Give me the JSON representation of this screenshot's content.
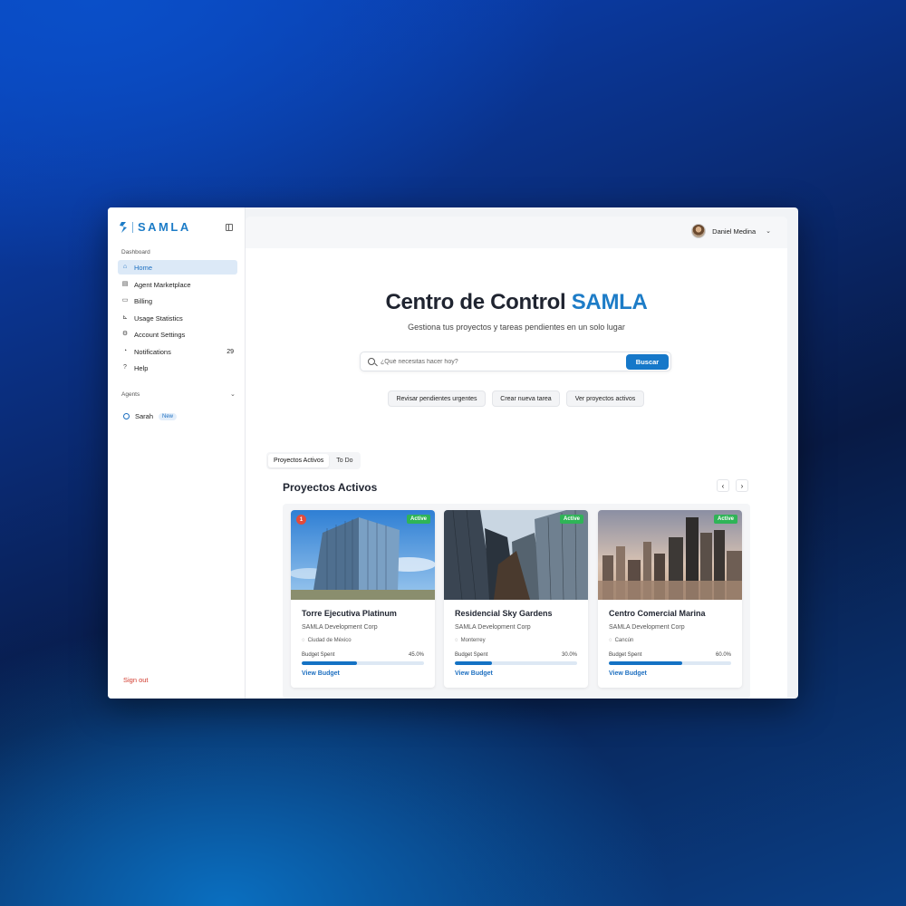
{
  "sidebar": {
    "brand": "SAMLA",
    "dashboard_label": "Dashboard",
    "items": [
      {
        "label": "Home",
        "icon": "home-icon",
        "active": true
      },
      {
        "label": "Agent Marketplace",
        "icon": "store-icon"
      },
      {
        "label": "Billing",
        "icon": "card-icon"
      },
      {
        "label": "Usage Statistics",
        "icon": "chart-icon"
      },
      {
        "label": "Account Settings",
        "icon": "gear-icon"
      },
      {
        "label": "Notifications",
        "icon": "bell-icon",
        "count": "29"
      },
      {
        "label": "Help",
        "icon": "help-icon"
      }
    ],
    "agents_label": "Agents",
    "agents": [
      {
        "name": "Sarah",
        "badge": "New"
      }
    ],
    "signout": "Sign out"
  },
  "header": {
    "user_name": "Daniel Medina"
  },
  "hero": {
    "title_main": "Centro de Control ",
    "title_accent": "SAMLA",
    "subtitle": "Gestiona tus proyectos y tareas pendientes en un solo lugar",
    "search_placeholder": "¿Qué necesitas hacer hoy?",
    "search_button": "Buscar",
    "quick_actions": [
      "Revisar pendientes urgentes",
      "Crear nueva tarea",
      "Ver proyectos activos"
    ]
  },
  "tabs": [
    "Proyectos Activos",
    "To Do"
  ],
  "projects_title": "Proyectos Activos",
  "projects": [
    {
      "title": "Torre Ejecutiva Platinum",
      "company": "SAMLA Development Corp",
      "location": "Ciudad de México",
      "status": "Active",
      "alert": "1",
      "budget_label": "Budget Spent",
      "budget_pct": "45.0%",
      "budget_value": 45,
      "link": "View Budget"
    },
    {
      "title": "Residencial Sky Gardens",
      "company": "SAMLA Development Corp",
      "location": "Monterrey",
      "status": "Active",
      "budget_label": "Budget Spent",
      "budget_pct": "30.0%",
      "budget_value": 30,
      "link": "View Budget"
    },
    {
      "title": "Centro Comercial Marina",
      "company": "SAMLA Development Corp",
      "location": "Cancún",
      "status": "Active",
      "budget_label": "Budget Spent",
      "budget_pct": "60.0%",
      "budget_value": 60,
      "link": "View Budget"
    }
  ],
  "colors": {
    "accent": "#1d7cc7",
    "button": "#1678c9",
    "status_active": "#2fb457",
    "alert": "#e24b3b",
    "signout": "#d23b2e"
  }
}
